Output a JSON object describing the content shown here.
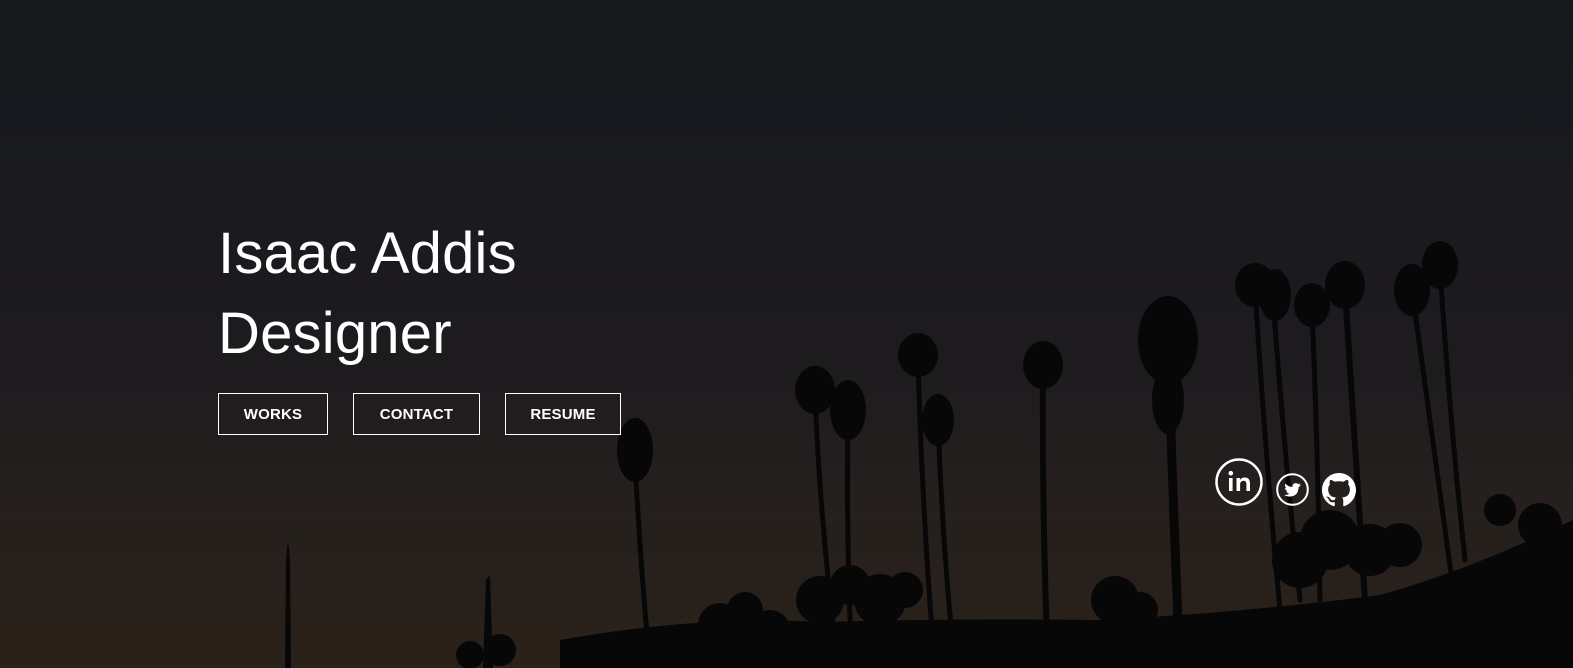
{
  "hero": {
    "name": "Isaac Addis",
    "role": "Designer"
  },
  "buttons": {
    "works": "WORKS",
    "contact": "CONTACT",
    "resume": "RESUME"
  },
  "social": [
    {
      "icon": "linkedin-icon"
    },
    {
      "icon": "twitter-icon"
    },
    {
      "icon": "github-icon"
    }
  ],
  "colors": {
    "text": "#ffffff",
    "sky_top": "#16181c",
    "sky_bottom": "#2a2119",
    "silhouette": "#060606"
  }
}
